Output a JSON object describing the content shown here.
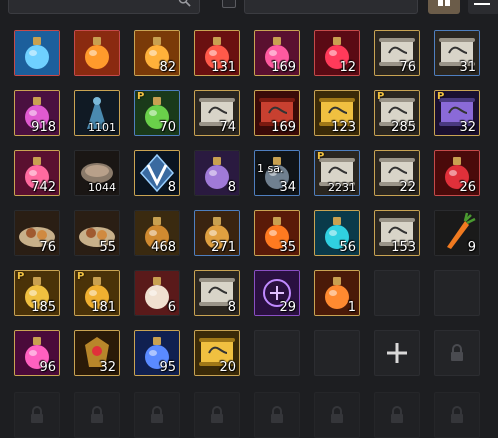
{
  "toolbar": {
    "search_icon": "search-icon",
    "view_icon": "grid-view-icon",
    "menu_icon": "menu-icon",
    "colors": {
      "active_button": "#6b5c49",
      "panel": "#1d1e21"
    }
  },
  "inventory": {
    "rows": [
      [
        {
          "item": "blue-elixir-bottle",
          "grade": "red",
          "qty": ""
        },
        {
          "item": "fire-elixir-bottle",
          "grade": "red",
          "qty": ""
        },
        {
          "item": "orange-potion",
          "grade": "gold",
          "qty": "82"
        },
        {
          "item": "red-potion",
          "grade": "gold",
          "qty": "131"
        },
        {
          "item": "pink-potion",
          "grade": "gold",
          "qty": "169"
        },
        {
          "item": "crimson-potion",
          "grade": "red",
          "qty": "12"
        },
        {
          "item": "scroll",
          "grade": "gold",
          "qty": "76"
        },
        {
          "item": "scroll",
          "grade": "blue",
          "qty": "31"
        }
      ],
      [
        {
          "item": "magenta-potion",
          "grade": "gold",
          "qty": "918"
        },
        {
          "item": "blue-cloak",
          "grade": "gold",
          "qty": "1101"
        },
        {
          "item": "green-potion",
          "grade": "blue",
          "qty": "70",
          "badge": "P"
        },
        {
          "item": "scroll",
          "grade": "gold",
          "qty": "74"
        },
        {
          "item": "red-scroll",
          "grade": "gold",
          "qty": "169"
        },
        {
          "item": "gold-scroll",
          "grade": "gold",
          "qty": "123"
        },
        {
          "item": "scroll",
          "grade": "gold",
          "qty": "285",
          "badge": "P"
        },
        {
          "item": "purple-scroll",
          "grade": "gold",
          "qty": "32",
          "badge": "P"
        }
      ],
      [
        {
          "item": "rose-potion",
          "grade": "gold",
          "qty": "742"
        },
        {
          "item": "bowl",
          "grade": "none",
          "qty": "1044"
        },
        {
          "item": "v-crystal",
          "grade": "gold",
          "qty": "8"
        },
        {
          "item": "violet-vial",
          "grade": "none",
          "qty": "8"
        },
        {
          "item": "dark-vial",
          "grade": "blue",
          "qty": "34",
          "label": "1 sa."
        },
        {
          "item": "scroll",
          "grade": "blue",
          "qty": "2231",
          "badge": "P"
        },
        {
          "item": "scroll",
          "grade": "gold",
          "qty": "22"
        },
        {
          "item": "red-orb-potion",
          "grade": "red",
          "qty": "26"
        }
      ],
      [
        {
          "item": "food-platter",
          "grade": "none",
          "qty": "76"
        },
        {
          "item": "food-platter-2",
          "grade": "none",
          "qty": "55"
        },
        {
          "item": "amber-jar",
          "grade": "none",
          "qty": "468"
        },
        {
          "item": "amber-bottle",
          "grade": "blue",
          "qty": "271"
        },
        {
          "item": "fire-potion",
          "grade": "gold",
          "qty": "35"
        },
        {
          "item": "cyan-potion",
          "grade": "gold",
          "qty": "56"
        },
        {
          "item": "scroll",
          "grade": "gold",
          "qty": "153"
        },
        {
          "item": "carrot",
          "grade": "none",
          "qty": "9"
        }
      ],
      [
        {
          "item": "gold-potion",
          "grade": "gold",
          "qty": "185",
          "badge": "P"
        },
        {
          "item": "gold-potion-2",
          "grade": "gold",
          "qty": "181",
          "badge": "P"
        },
        {
          "item": "vase",
          "grade": "none",
          "qty": "6"
        },
        {
          "item": "scroll",
          "grade": "gold",
          "qty": "8"
        },
        {
          "item": "rune-stone",
          "grade": "purple",
          "qty": "29"
        },
        {
          "item": "fire-flask",
          "grade": "gold",
          "qty": "1"
        },
        {
          "item": "empty",
          "grade": "empty",
          "qty": ""
        },
        {
          "item": "empty",
          "grade": "empty",
          "qty": ""
        }
      ],
      [
        {
          "item": "pink-vial",
          "grade": "gold",
          "qty": "96"
        },
        {
          "item": "gold-crest",
          "grade": "gold",
          "qty": "32"
        },
        {
          "item": "blue-potion",
          "grade": "gold",
          "qty": "95"
        },
        {
          "item": "gold-scroll",
          "grade": "gold",
          "qty": "20"
        },
        {
          "item": "empty",
          "grade": "empty",
          "qty": ""
        },
        {
          "item": "empty",
          "grade": "empty",
          "qty": ""
        },
        {
          "item": "add-slot",
          "grade": "empty",
          "qty": "",
          "icon": "plus-icon"
        },
        {
          "item": "locked-slot",
          "grade": "empty",
          "qty": "",
          "icon": "lock-icon"
        }
      ],
      [
        {
          "item": "locked-slot",
          "grade": "empty",
          "qty": "",
          "icon": "lock-icon"
        },
        {
          "item": "locked-slot",
          "grade": "empty",
          "qty": "",
          "icon": "lock-icon"
        },
        {
          "item": "locked-slot",
          "grade": "empty",
          "qty": "",
          "icon": "lock-icon"
        },
        {
          "item": "locked-slot",
          "grade": "empty",
          "qty": "",
          "icon": "lock-icon"
        },
        {
          "item": "locked-slot",
          "grade": "empty",
          "qty": "",
          "icon": "lock-icon"
        },
        {
          "item": "locked-slot",
          "grade": "empty",
          "qty": "",
          "icon": "lock-icon"
        },
        {
          "item": "locked-slot",
          "grade": "empty",
          "qty": "",
          "icon": "lock-icon"
        },
        {
          "item": "locked-slot",
          "grade": "empty",
          "qty": "",
          "icon": "lock-icon"
        }
      ]
    ]
  }
}
